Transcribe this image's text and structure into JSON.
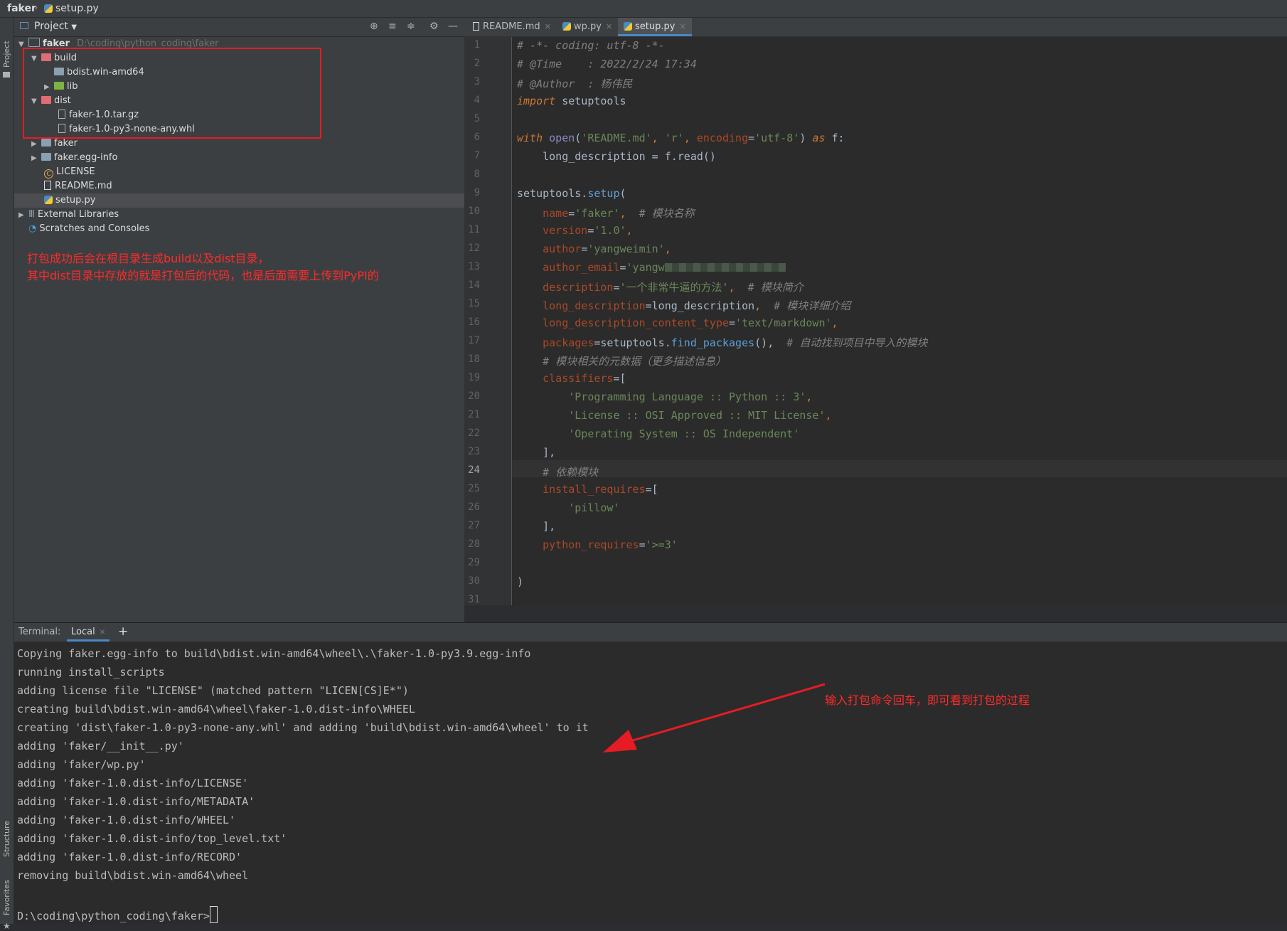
{
  "breadcrumb": {
    "project": "faker",
    "file": "setup.py"
  },
  "left_strip": {
    "project_label": "Project",
    "structure_label": "Structure",
    "favorites_label": "Favorites"
  },
  "project_panel": {
    "title": "Project",
    "tree": [
      {
        "label": "faker",
        "path": "D:\\coding\\python_coding\\faker"
      },
      {
        "label": "build"
      },
      {
        "label": "bdist.win-amd64"
      },
      {
        "label": "lib"
      },
      {
        "label": "dist"
      },
      {
        "label": "faker-1.0.tar.gz"
      },
      {
        "label": "faker-1.0-py3-none-any.whl"
      },
      {
        "label": "faker"
      },
      {
        "label": "faker.egg-info"
      },
      {
        "label": "LICENSE"
      },
      {
        "label": "README.md"
      },
      {
        "label": "setup.py"
      },
      {
        "label": "External Libraries"
      },
      {
        "label": "Scratches and Consoles"
      }
    ],
    "annotation_line1": "打包成功后会在根目录生成build以及dist目录，",
    "annotation_line2": "其中dist目录中存放的就是打包后的代码，也是后面需要上传到PyPI的"
  },
  "editor": {
    "tabs": [
      {
        "label": "README.md",
        "active": false
      },
      {
        "label": "wp.py",
        "active": false
      },
      {
        "label": "setup.py",
        "active": true
      }
    ],
    "current_line": 24,
    "line_numbers": [
      "1",
      "2",
      "3",
      "4",
      "5",
      "6",
      "7",
      "8",
      "9",
      "10",
      "11",
      "12",
      "13",
      "14",
      "15",
      "16",
      "17",
      "18",
      "19",
      "20",
      "21",
      "22",
      "23",
      "24",
      "25",
      "26",
      "27",
      "28",
      "29",
      "30",
      "31"
    ],
    "code": {
      "l1": "# -*- coding: utf-8 -*-",
      "l2": "# @Time    : 2022/2/24 17:34",
      "l3": "# @Author  : 杨伟民",
      "l4_kw": "import",
      "l4_rest": " setuptools",
      "l6_with": "with",
      "l6_open": "open",
      "l6_a": "(",
      "l6_s1": "'README.md'",
      "l6_b": ", ",
      "l6_s2": "'r'",
      "l6_c": ", ",
      "l6_p": "encoding",
      "l6_d": "=",
      "l6_s3": "'utf-8'",
      "l6_e": ") ",
      "l6_as": "as",
      "l6_f": " f:",
      "l7": "    long_description = f.",
      "l7_fn": "read",
      "l7_end": "()",
      "l9": "setuptools.",
      "l9_fn": "setup",
      "l9_end": "(",
      "l10_p": "    name",
      "l10_s": "'faker'",
      "l10_c": "  # 模块名称",
      "l11_p": "    version",
      "l11_s": "'1.0'",
      "l12_p": "    author",
      "l12_s": "'yangweimin'",
      "l13_p": "    author_email",
      "l13_s": "'yangw",
      "l14_p": "    description",
      "l14_s": "'一个非常牛逼的方法'",
      "l14_c": "  # 模块简介",
      "l15_p": "    long_description",
      "l15_v": "long_description",
      "l15_c": "  # 模块详细介绍",
      "l16_p": "    long_description_content_type",
      "l16_s": "'text/markdown'",
      "l17_p": "    packages",
      "l17_v": "setuptools.",
      "l17_fn": "find_packages",
      "l17_end": "(),",
      "l17_c": "  # 自动找到项目中导入的模块",
      "l18": "    # 模块相关的元数据（更多描述信息）",
      "l19_p": "    classifiers",
      "l20": "        'Programming Language :: Python :: 3'",
      "l21": "        'License :: OSI Approved :: MIT License'",
      "l22": "        'Operating System :: OS Independent'",
      "l23": "    ],",
      "l24": "    # 依赖模块",
      "l25_p": "    install_requires",
      "l26": "        'pillow'",
      "l27": "    ],",
      "l28_p": "    python_requires",
      "l28_s": "'>=3'",
      "l30": ")"
    }
  },
  "terminal": {
    "label": "Terminal:",
    "tab": "Local",
    "add": "+",
    "lines": [
      "Copying faker.egg-info to build\\bdist.win-amd64\\wheel\\.\\faker-1.0-py3.9.egg-info",
      "running install_scripts",
      "adding license file \"LICENSE\" (matched pattern \"LICEN[CS]E*\")",
      "creating build\\bdist.win-amd64\\wheel\\faker-1.0.dist-info\\WHEEL",
      "creating 'dist\\faker-1.0-py3-none-any.whl' and adding 'build\\bdist.win-amd64\\wheel' to it",
      "adding 'faker/__init__.py'",
      "adding 'faker/wp.py'",
      "adding 'faker-1.0.dist-info/LICENSE'",
      "adding 'faker-1.0.dist-info/METADATA'",
      "adding 'faker-1.0.dist-info/WHEEL'",
      "adding 'faker-1.0.dist-info/top_level.txt'",
      "adding 'faker-1.0.dist-info/RECORD'",
      "removing build\\bdist.win-amd64\\wheel"
    ],
    "prompt": "D:\\coding\\python_coding\\faker>",
    "annotation": "输入打包命令回车，即可看到打包的过程"
  },
  "colors": {
    "accent": "#4a88c7",
    "annotation": "#e51c23"
  }
}
